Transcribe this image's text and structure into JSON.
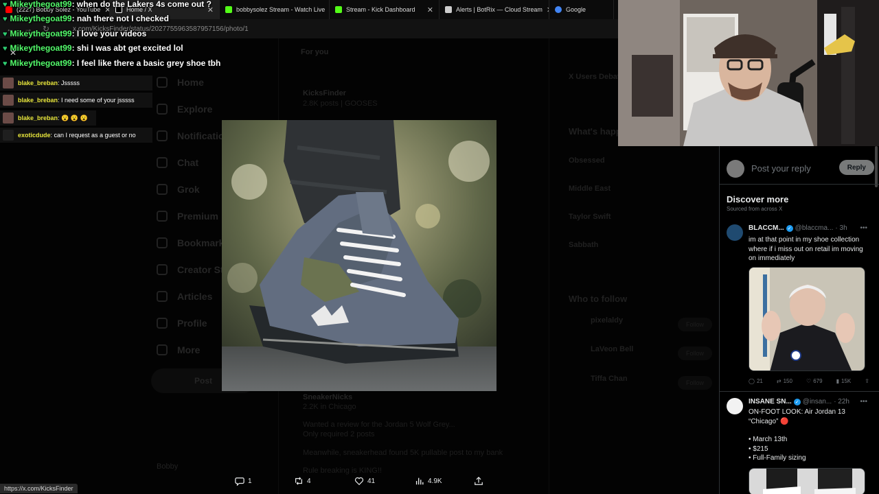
{
  "browser": {
    "tabs": [
      {
        "label": "(2227) Bobby Solez - YouTube",
        "color": "#ff0000"
      },
      {
        "label": "Home / X",
        "color": "#ffffff"
      },
      {
        "label": "bobbysolez Stream - Watch Live",
        "color": "#53fc18"
      },
      {
        "label": "Stream - Kick Dashboard",
        "color": "#53fc18"
      },
      {
        "label": "Alerts | BotRix — Cloud Stream",
        "color": "#cccccc"
      },
      {
        "label": "Google",
        "color": "#4285f4"
      }
    ],
    "url": "x.com/KicksFinder/status/2027755963587957156/photo/1",
    "status_url": "https://x.com/KicksFinder"
  },
  "chat": {
    "top_lines": [
      {
        "user": "Mikeythegoat99",
        "text": ": when do the Lakers 4s come out ?"
      },
      {
        "user": "Mikeythegoat99",
        "text": ": nah there not I checked"
      },
      {
        "user": "Mikeythegoat99",
        "text": ": I love your videos"
      },
      {
        "user": "Mikeythegoat99",
        "text": ": shi I was abt get excited lol"
      },
      {
        "user": "Mikeythegoat99",
        "text": ": I feel like there a basic grey shoe tbh"
      }
    ],
    "box_lines": [
      {
        "user": "blake_breban",
        "text": ": Jsssss"
      },
      {
        "user": "blake_breban",
        "text": ": I need some of your jsssss"
      },
      {
        "user": "blake_breban",
        "text": ": 😮 😮 😮"
      },
      {
        "user": "exoticdude",
        "text": ": can I request as a guest or no"
      }
    ]
  },
  "x_page": {
    "nav": [
      "Home",
      "Explore",
      "Notifications",
      "Chat",
      "Grok",
      "Premium",
      "Bookmarks",
      "Creator Studio",
      "Articles",
      "Profile",
      "More"
    ],
    "post_label": "Post",
    "profile_name": "Bobby",
    "feed_tab": "For you",
    "tweet_author": "KicksFinder",
    "tweet_text": "2.8K posts | GOOSES",
    "reply_author": "SneakerNicks",
    "reply_lines": [
      "2.2K in Chicago",
      "Wanted a review for the Jordan 5 Wolf Grey...",
      "Only required 2 posts",
      "Meanwhile, sneakerhead found 5K pullable post to my bank",
      "Rule breaking is KING!!"
    ],
    "trends": [
      "X Users Debate Prospects Depth",
      "What's happening",
      "Obsessed",
      "Middle East",
      "Taylor Swift",
      "Sabbath",
      "Who to follow"
    ],
    "follow_names": [
      "pixelaldy",
      "LaVeon Bell",
      "Tiffa Chan"
    ],
    "follow_label": "Follow"
  },
  "photo_actions": {
    "replies": "1",
    "reposts": "4",
    "likes": "41",
    "views": "4.9K"
  },
  "right_panel": {
    "reply_placeholder": "Post your reply",
    "reply_button": "Reply",
    "discover_title": "Discover more",
    "discover_sub": "Sourced from across X",
    "tweets": [
      {
        "name": "BLACCM...",
        "handle": "@blaccma...",
        "time": "· 3h",
        "text": "im at that point in my shoe collection where if i miss out on retail im moving on immediately",
        "stats": {
          "replies": "21",
          "reposts": "150",
          "likes": "679",
          "views": "15K"
        }
      },
      {
        "name": "INSANE SN...",
        "handle": "@insan...",
        "time": "· 22h",
        "text_lines": [
          "ON-FOOT LOOK: Air Jordan 13 “Chicago” 🔴",
          "",
          "• March 13th",
          "• $215",
          "• Full-Family sizing"
        ]
      }
    ]
  },
  "colors": {
    "accent_green": "#53fc6b",
    "kick_green": "#53fc18",
    "x_blue": "#1d9bf0",
    "chat_yellow": "#e8e63c"
  }
}
